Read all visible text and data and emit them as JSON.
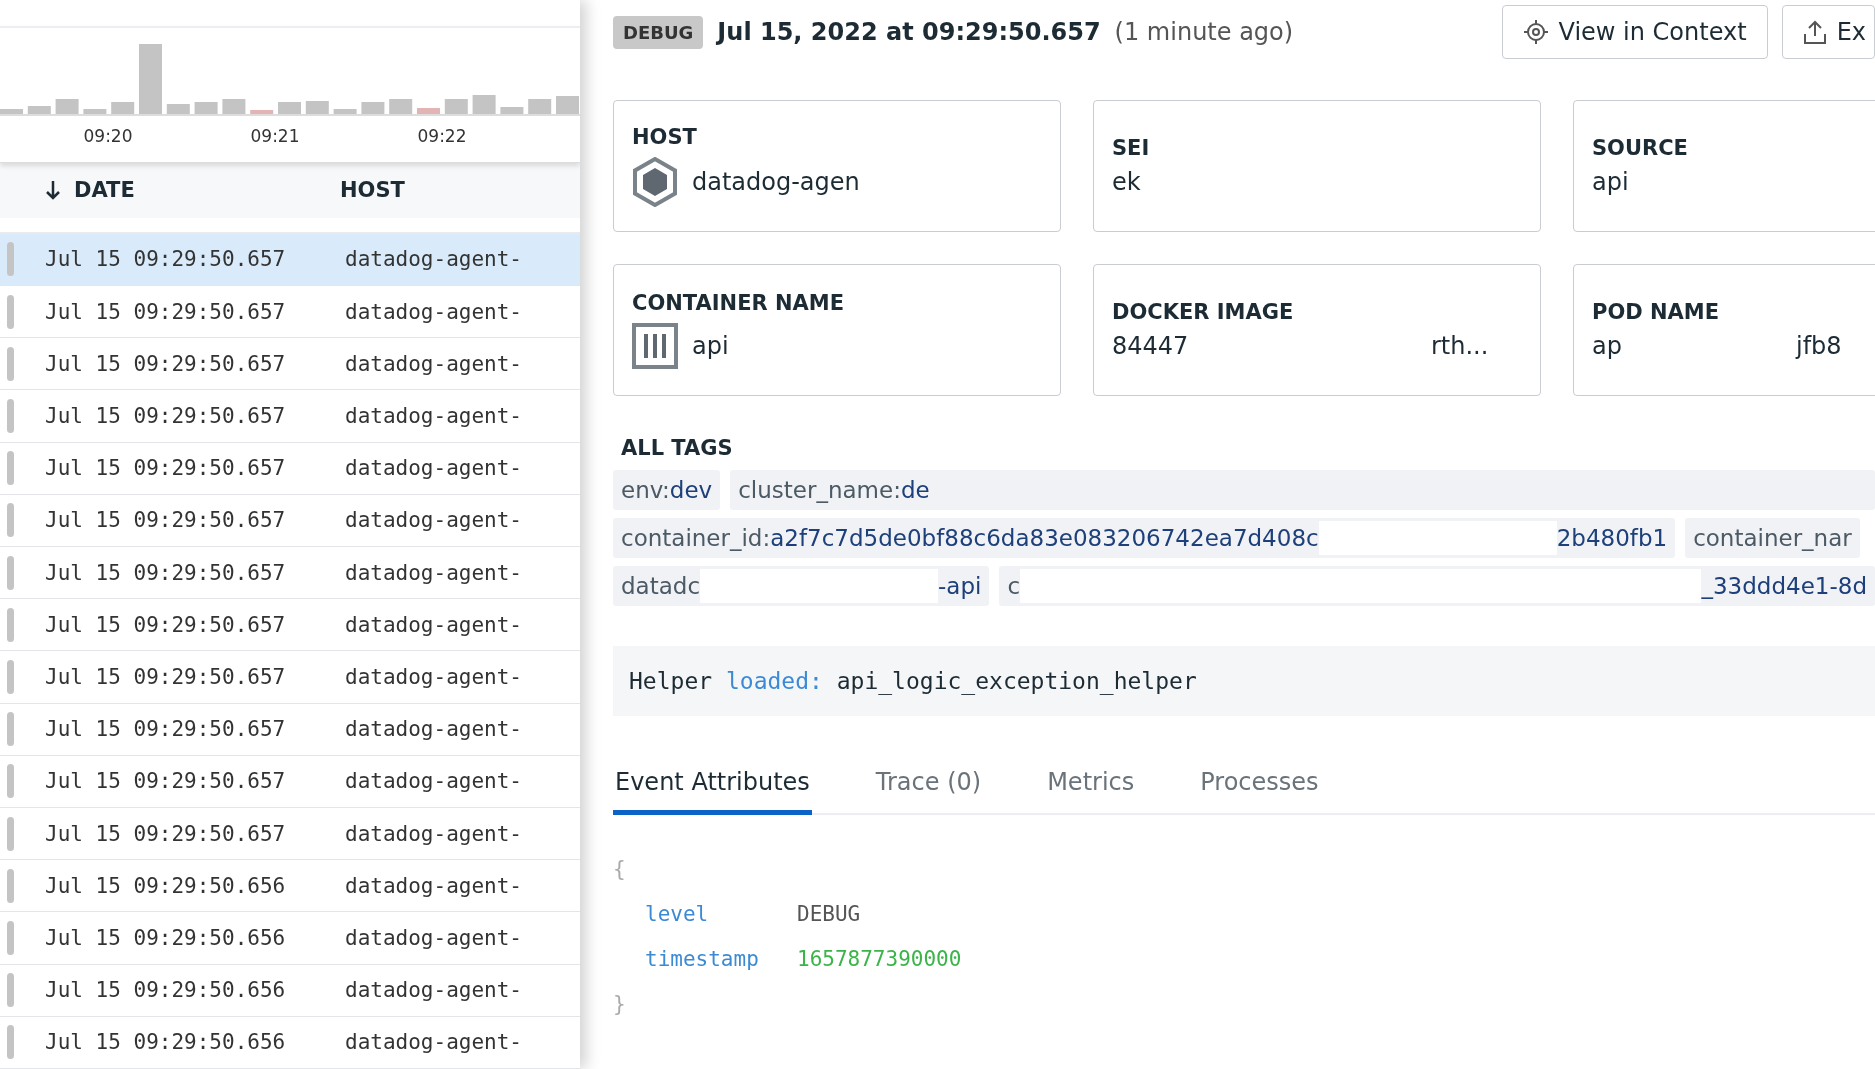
{
  "histogram": {
    "ticks": [
      "09:20",
      "09:21",
      "09:22"
    ]
  },
  "log_table": {
    "columns": [
      {
        "label": "DATE",
        "sorted": true
      },
      {
        "label": "HOST",
        "sorted": false
      }
    ],
    "rows": [
      {
        "date": "Jul 15 09:29:50.657",
        "host": "datadog-agent-",
        "selected": true
      },
      {
        "date": "Jul 15 09:29:50.657",
        "host": "datadog-agent-",
        "selected": false
      },
      {
        "date": "Jul 15 09:29:50.657",
        "host": "datadog-agent-",
        "selected": false
      },
      {
        "date": "Jul 15 09:29:50.657",
        "host": "datadog-agent-",
        "selected": false
      },
      {
        "date": "Jul 15 09:29:50.657",
        "host": "datadog-agent-",
        "selected": false
      },
      {
        "date": "Jul 15 09:29:50.657",
        "host": "datadog-agent-",
        "selected": false
      },
      {
        "date": "Jul 15 09:29:50.657",
        "host": "datadog-agent-",
        "selected": false
      },
      {
        "date": "Jul 15 09:29:50.657",
        "host": "datadog-agent-",
        "selected": false
      },
      {
        "date": "Jul 15 09:29:50.657",
        "host": "datadog-agent-",
        "selected": false
      },
      {
        "date": "Jul 15 09:29:50.657",
        "host": "datadog-agent-",
        "selected": false
      },
      {
        "date": "Jul 15 09:29:50.657",
        "host": "datadog-agent-",
        "selected": false
      },
      {
        "date": "Jul 15 09:29:50.657",
        "host": "datadog-agent-",
        "selected": false
      },
      {
        "date": "Jul 15 09:29:50.656",
        "host": "datadog-agent-",
        "selected": false
      },
      {
        "date": "Jul 15 09:29:50.656",
        "host": "datadog-agent-",
        "selected": false
      },
      {
        "date": "Jul 15 09:29:50.656",
        "host": "datadog-agent-",
        "selected": false
      },
      {
        "date": "Jul 15 09:29:50.656",
        "host": "datadog-agent-",
        "selected": false
      }
    ]
  },
  "detail": {
    "status": "DEBUG",
    "timestamp": "Jul 15, 2022 at 09:29:50.657",
    "relative_time": "(1 minute ago)",
    "buttons": [
      {
        "label": "View in Context",
        "kind": "target"
      },
      {
        "label": "Ex",
        "kind": "export"
      }
    ],
    "cards": [
      {
        "label": "HOST",
        "kind": "host",
        "values": [
          "datadog-agen"
        ]
      },
      {
        "label": "SEI",
        "kind": "plain",
        "values": [
          "ek"
        ]
      },
      {
        "label": "SOURCE",
        "kind": "plain",
        "values": [
          "api"
        ]
      },
      {
        "label": "CONTAINER NAME",
        "kind": "container",
        "values": [
          "api"
        ]
      },
      {
        "label": "DOCKER IMAGE",
        "kind": "plain",
        "values": [
          "84447",
          "rth..."
        ]
      },
      {
        "label": "POD NAME",
        "kind": "plain",
        "values": [
          "ap",
          "jfb8"
        ]
      }
    ],
    "tags_title": "ALL TAGS",
    "tag_rows": [
      [
        {
          "segments": [
            {
              "kind": "key",
              "text": "env:"
            },
            {
              "kind": "value",
              "text": "dev"
            }
          ]
        },
        {
          "segments": [
            {
              "kind": "key",
              "text": "cluster_name:"
            },
            {
              "kind": "value",
              "text": "de"
            }
          ]
        }
      ],
      [
        {
          "segments": [
            {
              "kind": "key",
              "text": "container_id:"
            },
            {
              "kind": "value",
              "text": "a2f7c7d5de0bf88c6da83e083206742ea7d408c"
            },
            {
              "kind": "gap"
            },
            {
              "kind": "value",
              "text": "2b480fb1"
            }
          ]
        },
        {
          "segments": [
            {
              "kind": "key",
              "text": "container_nar"
            }
          ]
        }
      ],
      [
        {
          "segments": [
            {
              "kind": "key",
              "text": "datadc"
            },
            {
              "kind": "gap"
            },
            {
              "kind": "value",
              "text": "-api"
            }
          ]
        },
        {
          "segments": [
            {
              "kind": "key",
              "text": "c"
            },
            {
              "kind": "gap"
            },
            {
              "kind": "value",
              "text": "_33ddd4e1-8d"
            }
          ]
        }
      ]
    ],
    "message": [
      {
        "kind": "text",
        "text": "Helper "
      },
      {
        "kind": "keyword",
        "text": "loaded:"
      },
      {
        "kind": "text",
        "text": " api_logic_exception_helper"
      }
    ],
    "tabs": [
      {
        "label": "Event Attributes",
        "selected": true
      },
      {
        "label": "Trace (0)",
        "selected": false
      },
      {
        "label": "Metrics",
        "selected": false
      },
      {
        "label": "Processes",
        "selected": false
      }
    ],
    "attributes": {
      "open_brace": "{",
      "close_brace": "}",
      "items": [
        {
          "key": "level",
          "value": "DEBUG",
          "kind": "string"
        },
        {
          "key": "timestamp",
          "value": "1657877390000",
          "kind": "number"
        }
      ]
    }
  }
}
